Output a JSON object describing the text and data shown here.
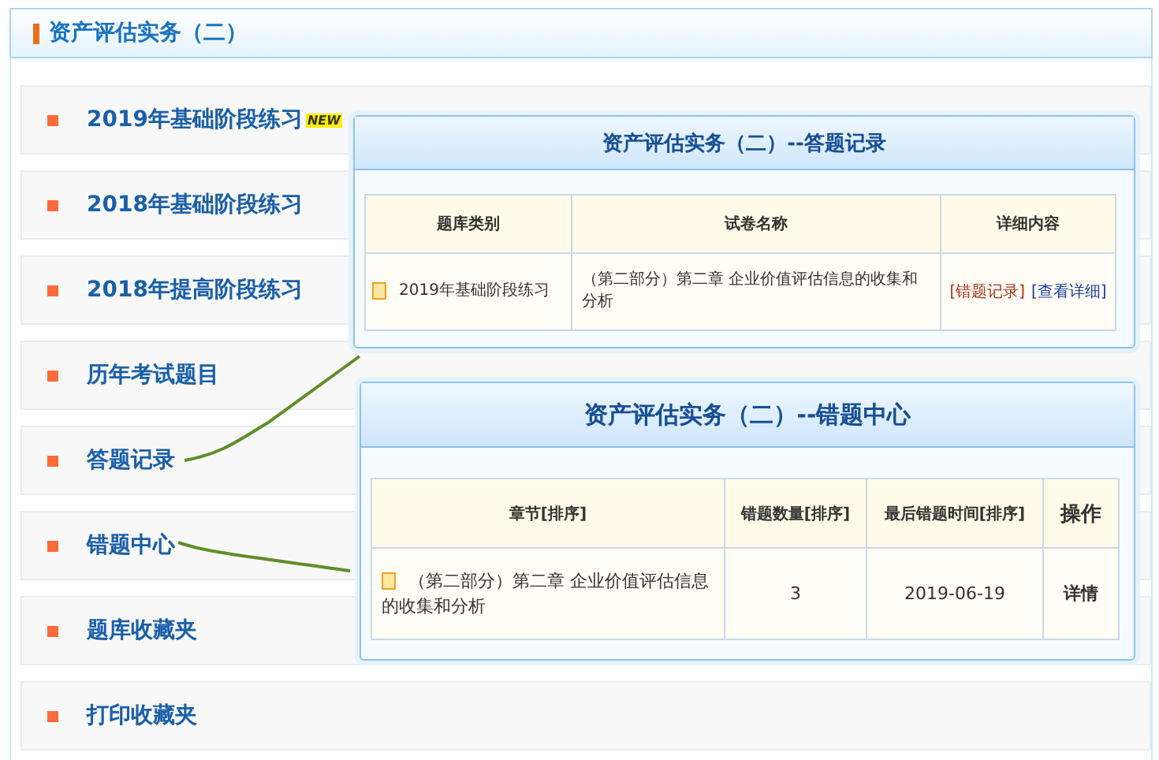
{
  "header": {
    "title": "资产评估实务（二）"
  },
  "menu": [
    {
      "label": "2019年基础阶段练习",
      "badge": "NEW"
    },
    {
      "label": "2018年基础阶段练习"
    },
    {
      "label": "2018年提高阶段练习"
    },
    {
      "label": "历年考试题目"
    },
    {
      "label": "答题记录"
    },
    {
      "label": "错题中心"
    },
    {
      "label": "题库收藏夹"
    },
    {
      "label": "打印收藏夹"
    }
  ],
  "answer_records": {
    "title": "资产评估实务（二）--答题记录",
    "columns": [
      "题库类别",
      "试卷名称",
      "详细内容"
    ],
    "rows": [
      {
        "category": "2019年基础阶段练习",
        "paper": "（第二部分）第二章  企业价值评估信息的收集和分析",
        "links": [
          {
            "text": "[错题记录]",
            "kind": "primary"
          },
          {
            "text": "[查看详细]",
            "kind": "secondary"
          }
        ]
      }
    ]
  },
  "wrong_center": {
    "title": "资产评估实务（二）--错题中心",
    "columns": [
      "章节[排序]",
      "错题数量[排序]",
      "最后错题时间[排序]",
      "操作"
    ],
    "rows": [
      {
        "chapter": "（第二部分）第二章   企业价值评估信息的收集和分析",
        "count": "3",
        "last_time": "2019-06-19",
        "action": "详情"
      }
    ]
  }
}
